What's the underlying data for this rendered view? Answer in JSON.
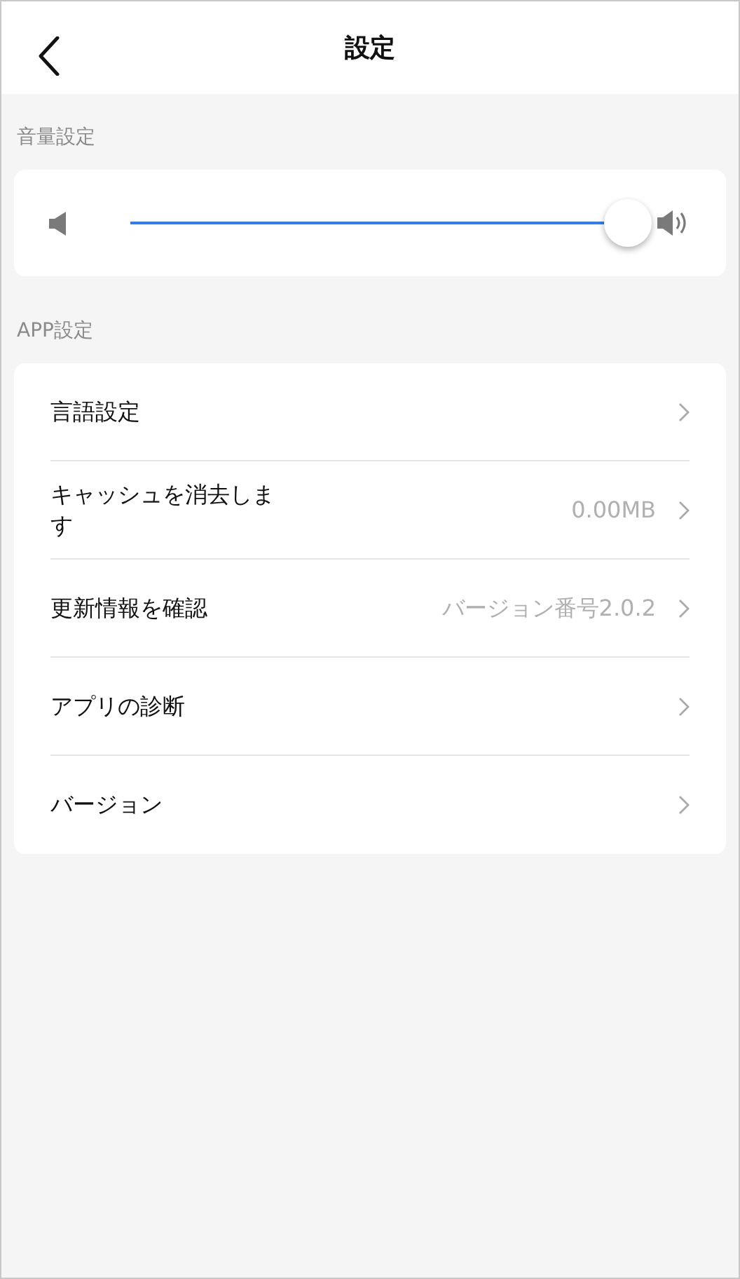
{
  "header": {
    "title": "設定"
  },
  "volume": {
    "label": "音量設定",
    "level": 1
  },
  "app_settings": {
    "label": "APP設定",
    "items": [
      {
        "label": "言語設定"
      },
      {
        "label": "キャッシュを消去します",
        "value": "0.00MB"
      },
      {
        "label": "更新情報を確認",
        "value": "バージョン番号2.0.2"
      },
      {
        "label": "アプリの診断"
      },
      {
        "label": "バージョン"
      }
    ]
  }
}
